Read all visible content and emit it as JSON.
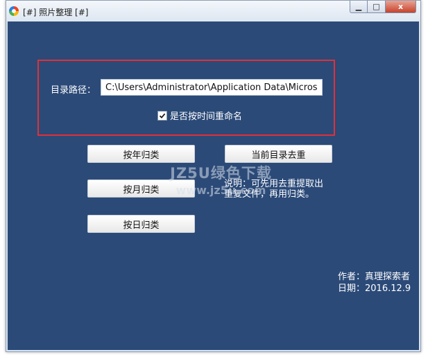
{
  "window": {
    "title": "[#] 照片整理 [#]",
    "controls": {
      "minimize": "▁",
      "maximize": "□",
      "close": "x"
    }
  },
  "path_group": {
    "label": "目录路径：",
    "path_value": "C:\\Users\\Administrator\\Application Data\\Microso",
    "rename_checkbox": {
      "label": "是否按时间重命名",
      "checked": true
    }
  },
  "buttons": {
    "by_year": "按年归类",
    "by_month": "按月归类",
    "by_day": "按日归类",
    "dedupe": "当前目录去重"
  },
  "note": {
    "line1": "说明：可先用去重提取出",
    "line2": "重复文件，再用归类。"
  },
  "credits": {
    "author": "作者：真理探索者",
    "date": "日期：2016.12.9"
  },
  "watermark": {
    "line1": "JZ5U绿色下载",
    "line2": "www.jz5u.com"
  },
  "colors": {
    "client_background": "#2b4a78",
    "group_border": "#e0303a",
    "text": "#ffffff"
  }
}
